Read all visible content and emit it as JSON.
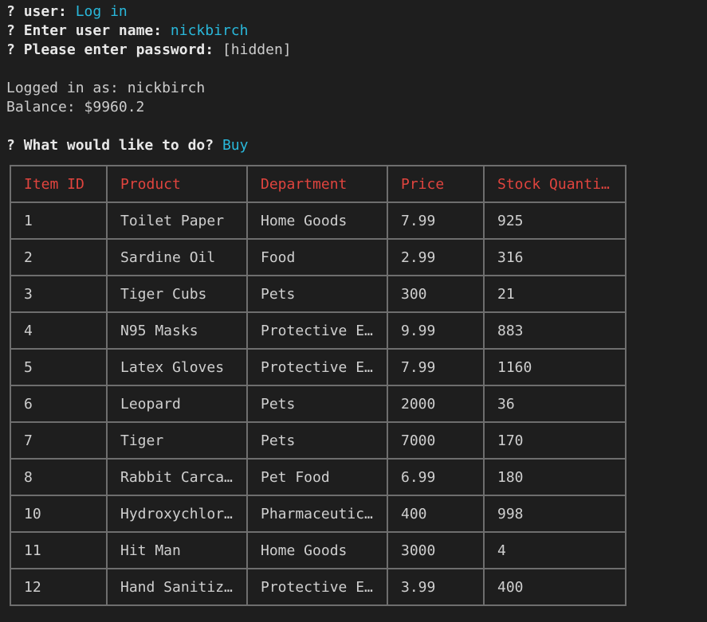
{
  "prompts": {
    "marker": "?",
    "user_q": "user:",
    "user_a": "Log in",
    "name_q": "Enter user name:",
    "name_a": "nickbirch",
    "pass_q": "Please enter password:",
    "pass_a": "[hidden]",
    "action_q": "What would like to do?",
    "action_a": "Buy"
  },
  "session": {
    "logged_in": "Logged in as: nickbirch",
    "balance": "Balance: $9960.2"
  },
  "table": {
    "headers": [
      "Item ID",
      "Product",
      "Department",
      "Price",
      "Stock Quanti…"
    ],
    "rows": [
      [
        "1",
        "Toilet Paper",
        "Home Goods",
        "7.99",
        "925"
      ],
      [
        "2",
        "Sardine Oil",
        "Food",
        "2.99",
        "316"
      ],
      [
        "3",
        "Tiger Cubs",
        "Pets",
        "300",
        "21"
      ],
      [
        "4",
        "N95 Masks",
        "Protective E…",
        "9.99",
        "883"
      ],
      [
        "5",
        "Latex Gloves",
        "Protective E…",
        "7.99",
        "1160"
      ],
      [
        "6",
        "Leopard",
        "Pets",
        "2000",
        "36"
      ],
      [
        "7",
        "Tiger",
        "Pets",
        "7000",
        "170"
      ],
      [
        "8",
        "Rabbit Carca…",
        "Pet Food",
        "6.99",
        "180"
      ],
      [
        "10",
        "Hydroxychlor…",
        "Pharmaceutic…",
        "400",
        "998"
      ],
      [
        "11",
        "Hit Man",
        "Home Goods",
        "3000",
        "4"
      ],
      [
        "12",
        "Hand Sanitiz…",
        "Protective E…",
        "3.99",
        "400"
      ]
    ]
  },
  "colors": {
    "background": "#1e1e1e",
    "question_mark": "#23d18b",
    "answer": "#29b8db",
    "header": "#e0443e",
    "border": "#6e6e6e"
  }
}
